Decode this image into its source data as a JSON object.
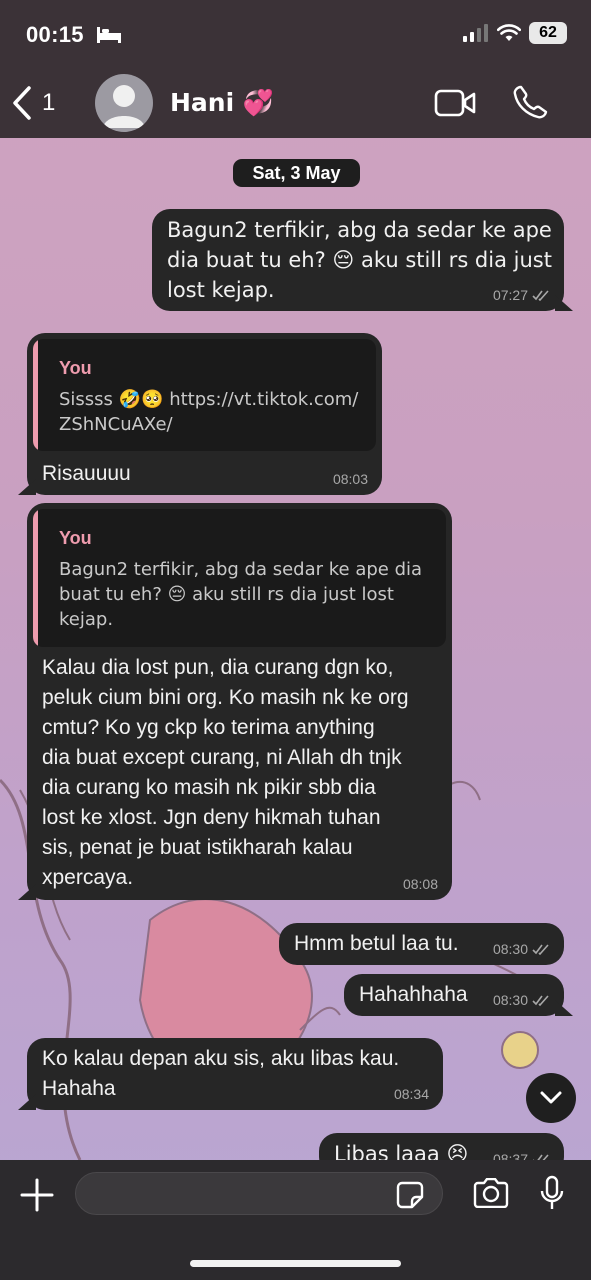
{
  "status_bar": {
    "time": "00:15",
    "battery": "62"
  },
  "header": {
    "back_count": "1",
    "contact_name": "Hani 💞"
  },
  "date_chip": "Sat, 3 May",
  "messages": [
    {
      "direction": "out",
      "lines": [
        "Bagun2 terfikir, abg da sedar ke ape",
        "dia buat tu eh? 😔 aku still rs dia just",
        "lost kejap."
      ],
      "time": "07:27"
    },
    {
      "direction": "in",
      "quote_name": "You",
      "quote_lines": [
        "Sissss 🤣🥺 https://vt.tiktok.com/",
        "ZShNCuAXe/"
      ],
      "lines": [
        "Risauuuu"
      ],
      "time": "08:03"
    },
    {
      "direction": "in",
      "quote_name": "You",
      "quote_lines": [
        "Bagun2 terfikir, abg da sedar ke ape dia",
        "buat tu eh? 😔 aku still rs dia just lost",
        "kejap."
      ],
      "lines": [
        "Kalau dia lost pun, dia curang dgn ko,",
        "peluk cium bini org. Ko masih nk ke org",
        "cmtu? Ko yg ckp ko terima anything",
        "dia buat except curang, ni Allah dh tnjk",
        "dia curang ko masih nk pikir sbb dia",
        "lost ke xlost. Jgn deny hikmah tuhan",
        "sis, penat je buat istikharah kalau",
        "xpercaya."
      ],
      "time": "08:08"
    },
    {
      "direction": "out",
      "lines": [
        "Hmm betul laa tu."
      ],
      "time": "08:30"
    },
    {
      "direction": "out",
      "lines": [
        "Hahahhaha"
      ],
      "time": "08:30"
    },
    {
      "direction": "in",
      "lines": [
        "Ko kalau depan aku sis, aku libas kau.",
        "Hahaha"
      ],
      "time": "08:34"
    },
    {
      "direction": "out",
      "lines": [
        "Libas laaa 😣"
      ],
      "time": "08:37"
    }
  ],
  "icons": {
    "back": "chevron-left-icon",
    "video": "video-camera-icon",
    "call": "phone-icon",
    "plus": "plus-icon",
    "sticker": "sticker-icon",
    "camera": "camera-icon",
    "mic": "microphone-icon",
    "read": "double-check-icon",
    "scroll": "chevron-down-icon"
  },
  "colors": {
    "bubble": "#262626",
    "quote_accent": "#ee9cae",
    "header": "#3b3237",
    "input_bar": "#2c2a2d"
  }
}
